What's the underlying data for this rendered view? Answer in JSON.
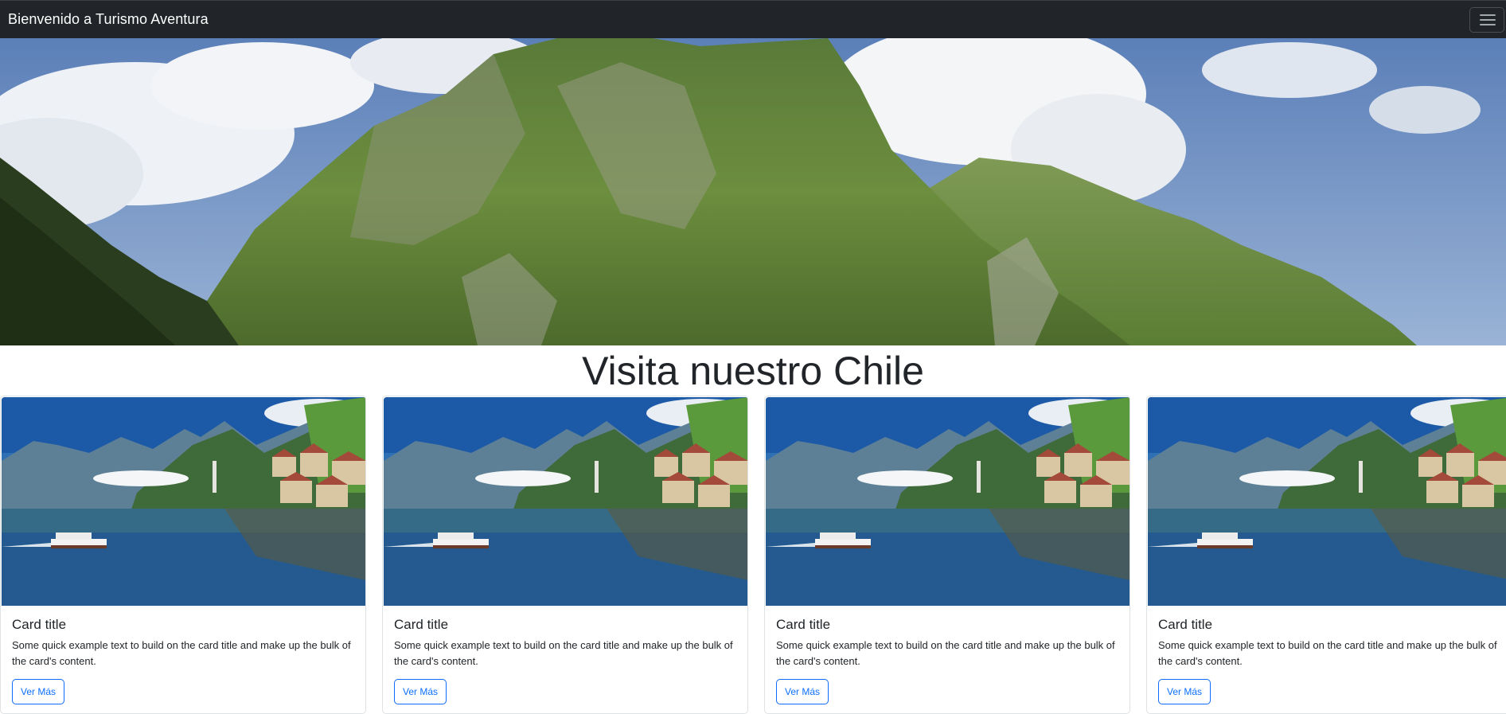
{
  "navbar": {
    "brand": "Bienvenido a Turismo Aventura",
    "toggler_icon": "hamburger-menu-icon"
  },
  "hero": {
    "image": "mountain-landscape"
  },
  "main": {
    "heading": "Visita nuestro Chile"
  },
  "cards": [
    {
      "image": "lake-village",
      "title": "Card title",
      "text": "Some quick example text to build on the card title and make up the bulk of the card's content.",
      "button_label": "Ver Más"
    },
    {
      "image": "lake-village",
      "title": "Card title",
      "text": "Some quick example text to build on the card title and make up the bulk of the card's content.",
      "button_label": "Ver Más"
    },
    {
      "image": "lake-village",
      "title": "Card title",
      "text": "Some quick example text to build on the card title and make up the bulk of the card's content.",
      "button_label": "Ver Más"
    },
    {
      "image": "lake-village",
      "title": "Card title",
      "text": "Some quick example text to build on the card title and make up the bulk of the card's content.",
      "button_label": "Ver Más"
    }
  ],
  "colors": {
    "navbar_bg": "#212529",
    "primary": "#0d6efd",
    "text": "#212529"
  }
}
